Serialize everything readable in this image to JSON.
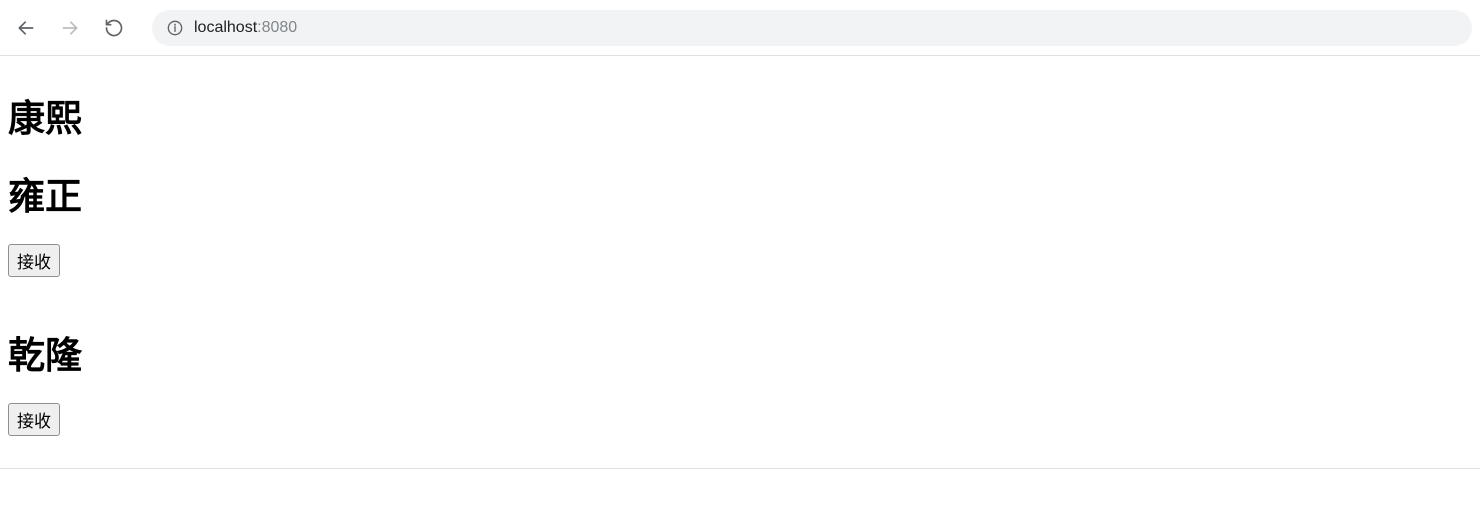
{
  "browser": {
    "url_host": "localhost",
    "url_port": ":8080"
  },
  "content": {
    "heading1": "康熙",
    "heading2": "雍正",
    "button1": "接收",
    "heading3": "乾隆",
    "button2": "接收"
  }
}
